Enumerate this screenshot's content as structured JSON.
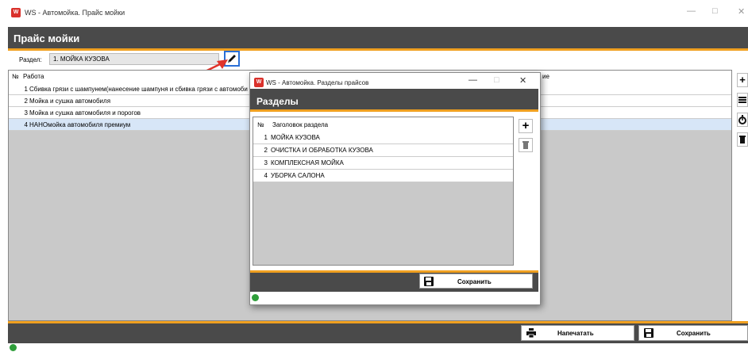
{
  "window": {
    "app_icon": "W",
    "title": "WS - Автомойка. Прайс мойки",
    "minimize": "—",
    "maximize": "□",
    "close": "✕"
  },
  "header": {
    "title": "Прайс мойки"
  },
  "section": {
    "label": "Раздел:",
    "value": "1. МОЙКА КУЗОВА"
  },
  "grid": {
    "columns": [
      "№",
      "Работа",
      "ие"
    ],
    "rows": [
      {
        "num": "1",
        "work": "Сбивка грязи с шампунем(нанесение шампуня и сбивка грязи с автомоби"
      },
      {
        "num": "2",
        "work": "Мойка и сушка автомобиля"
      },
      {
        "num": "3",
        "work": "Мойка и сушка автомобиля и порогов"
      },
      {
        "num": "4",
        "work": "НАНОмойка автомобиля премиум",
        "selected": true
      }
    ]
  },
  "side_buttons": [
    "add-icon",
    "list-icon",
    "stopwatch-icon",
    "trash-icon"
  ],
  "footer": {
    "print_label": "Напечатать",
    "save_label": "Сохранить"
  },
  "dialog": {
    "app_icon": "W",
    "title": "WS - Автомойка. Разделы прайсов",
    "minimize": "—",
    "maximize": "□",
    "close": "✕",
    "header": "Разделы",
    "columns": [
      "№",
      "Заголовок раздела"
    ],
    "rows": [
      {
        "num": "1",
        "title": "МОЙКА КУЗОВА"
      },
      {
        "num": "2",
        "title": "ОЧИСТКА И ОБРАБОТКА КУЗОВА"
      },
      {
        "num": "3",
        "title": "КОМПЛЕКСНАЯ МОЙКА"
      },
      {
        "num": "4",
        "title": "УБОРКА САЛОНА"
      }
    ],
    "save_label": "Сохранить"
  },
  "colors": {
    "accent": "#f0a020",
    "header_bg": "#4a4a4a",
    "selection": "#d7e6f7",
    "arrow": "#e0332a",
    "status_ok": "#2e9e3a"
  }
}
